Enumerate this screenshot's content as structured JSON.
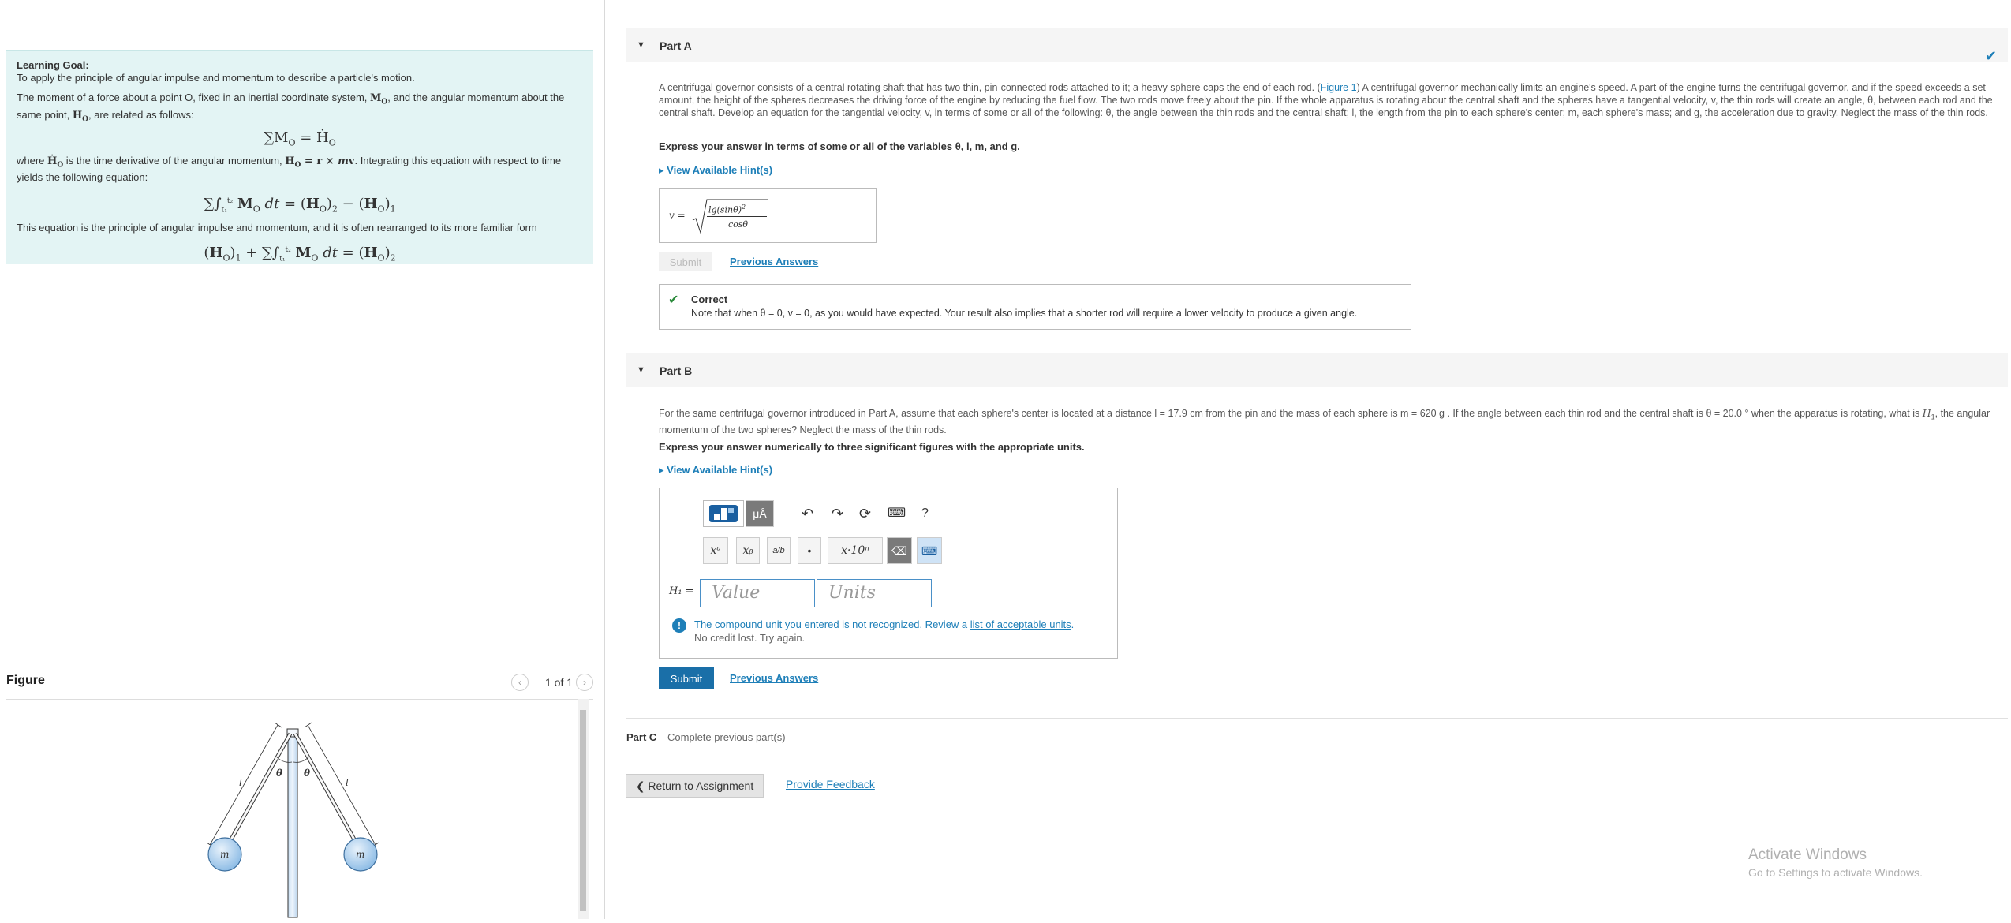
{
  "learning_goal": {
    "title": "Learning Goal:",
    "subtitle": "To apply the principle of angular impulse and momentum to describe a particle's motion.",
    "para1_a": "The moment of a force about a point O, fixed in an inertial coordinate system, ",
    "para1_b": ", and the angular momentum about the same point, ",
    "para1_c": ", are related as follows:",
    "eq1": "∑M",
    "para2_a": "where ",
    "para2_b": " is the time derivative of the angular momentum, ",
    "para2_c": ". Integrating this equation with respect to time yields the following equation:",
    "para3": "This equation is the principle of angular impulse and momentum, and it is often rearranged to its more familiar form"
  },
  "figure": {
    "title": "Figure",
    "counter": "1 of 1",
    "labels": {
      "l": "l",
      "theta": "θ",
      "m": "m"
    }
  },
  "part_a": {
    "title": "Part A",
    "problem_a": "A centrifugal governor consists of a central rotating shaft that has two thin, pin-connected rods attached to it; a heavy sphere caps the end of each rod. (",
    "figure_link": "Figure 1",
    "problem_b": ") A centrifugal governor mechanically limits an engine's speed. A part of the engine turns the centrifugal governor, and if the speed exceeds a set amount, the height of the spheres decreases the driving force of the engine by reducing the fuel flow. The two rods move freely about the pin. If the whole apparatus is rotating about the central shaft and the spheres have a tangential velocity, v, the thin rods will create an angle, θ, between each rod and the central shaft.  Develop an equation for the tangential velocity, v, in terms of some or all of the following: θ, the angle between the thin rods and the central shaft; l, the length from the pin to each sphere's center; m, each sphere's mass; and g, the acceleration due to gravity.  Neglect the mass of the thin rods.",
    "instruction": "Express your answer in terms of some or all of the variables θ, l, m, and g.",
    "hint_label": "View Available Hint(s)",
    "answer_var": "v =",
    "answer_num": "lg(sinθ)",
    "answer_den": "cosθ",
    "submit_label": "Submit",
    "previous_answers": "Previous Answers",
    "feedback_title": "Correct",
    "feedback_note": "Note that when θ = 0, v = 0, as you would have expected. Your result also implies that a shorter rod will require a lower velocity to produce a given angle."
  },
  "part_b": {
    "title": "Part B",
    "problem_a": "For the same centrifugal governor introduced in Part A, assume that each sphere's center is located at a distance l = 17.9 cm from the pin and the mass of each sphere is m = 620 g . If the angle between each thin rod and the central shaft is θ = 20.0 ° when the apparatus is rotating, what is ",
    "problem_b": ", the angular momentum of the two spheres? Neglect the mass of the thin rods.",
    "instruction": "Express your answer numerically to three significant figures with the appropriate units.",
    "hint_label": "View Available Hint(s)",
    "answer_var": "H₁ =",
    "value_placeholder": "Value",
    "units_placeholder": "Units",
    "toolbar": {
      "units_btn": "μÅ",
      "help": "?",
      "superscript": "xᵃ",
      "subscript": "xᵦ",
      "fraction": "a/b",
      "dot": "•",
      "sci": "x·10ⁿ"
    },
    "error_text_a": "The compound unit you entered is not recognized. Review a ",
    "error_link": "list of acceptable units",
    "error_text_b": ".",
    "error_sub": "No credit lost. Try again.",
    "submit_label": "Submit",
    "previous_answers": "Previous Answers"
  },
  "part_c": {
    "title": "Part C",
    "status": "Complete previous part(s)"
  },
  "footer": {
    "return_label": "Return to Assignment",
    "feedback_link": "Provide Feedback"
  },
  "watermark": {
    "title": "Activate Windows",
    "subtitle": "Go to Settings to activate Windows."
  }
}
